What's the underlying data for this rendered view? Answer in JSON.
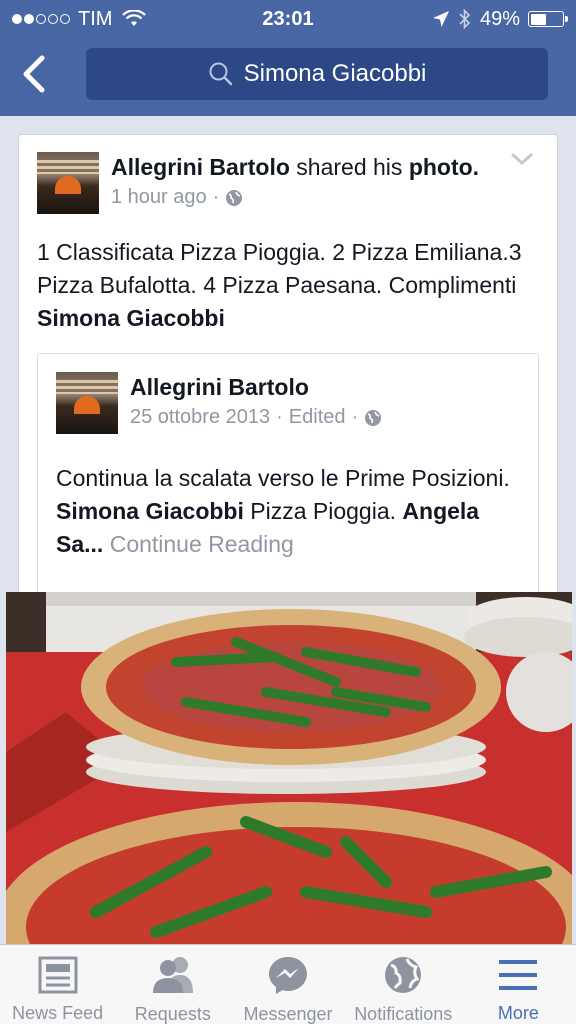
{
  "status": {
    "carrier": "TIM",
    "time": "23:01",
    "battery": "49%",
    "battery_level": 0.49
  },
  "nav": {
    "search_text": "Simona Giacobbi"
  },
  "post": {
    "author": "Allegrini Bartolo",
    "action": " shared his ",
    "object": "photo.",
    "time": "1 hour ago",
    "separator": "·",
    "text_part1": "1 Classificata Pizza Pioggia. 2 Pizza Emiliana.3 Pizza Bufalotta. 4 Pizza Paesana. Complimenti ",
    "text_mention": "Simona Giacobbi"
  },
  "shared": {
    "author": "Allegrini Bartolo",
    "date": "25 ottobre 2013",
    "edited": "Edited",
    "separator": "·",
    "text_part1": "Continua la scalata verso le Prime Posizioni. ",
    "mention1": "Simona Giacobbi",
    "text_part2": " Pizza Pioggia. ",
    "mention2": "Angela Sa...",
    "continue": " Continue Reading"
  },
  "tabs": [
    {
      "label": "News Feed",
      "icon": "news-feed-icon"
    },
    {
      "label": "Requests",
      "icon": "friend-requests-icon"
    },
    {
      "label": "Messenger",
      "icon": "messenger-icon"
    },
    {
      "label": "Notifications",
      "icon": "globe-icon"
    },
    {
      "label": "More",
      "icon": "menu-icon"
    }
  ],
  "colors": {
    "header": "#4a67a5",
    "search_bg": "#2d4886",
    "active_tab": "#4a6fb5",
    "inactive_tab": "#8e949f"
  }
}
